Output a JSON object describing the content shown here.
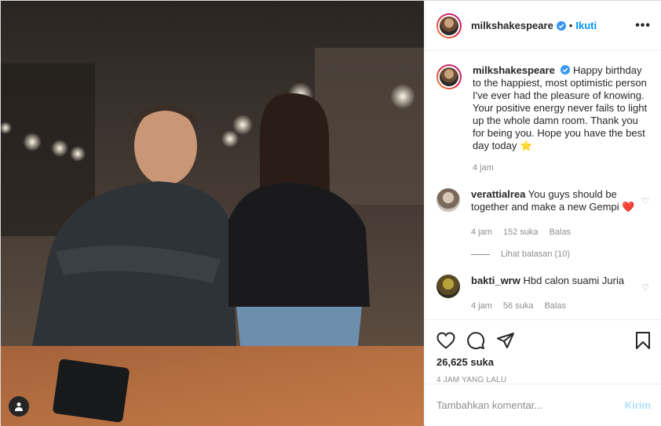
{
  "header": {
    "username": "milkshakespeare",
    "separator": "•",
    "follow_label": "Ikuti",
    "more_label": "•••"
  },
  "caption": {
    "username": "milkshakespeare",
    "text": "Happy birthday to the happiest, most optimistic person I've ever had the pleasure of knowing. Your positive energy never fails to light up the whole damn room. Thank you for being you. Hope you have the best day today ⭐",
    "time": "4 jam"
  },
  "comments": [
    {
      "username": "verattialrea",
      "text": "You guys should be together and make a new Gempi ❤️",
      "time": "4 jam",
      "likes": "152 suka",
      "reply_label": "Balas",
      "view_replies": "Lihat balasan (10)"
    },
    {
      "username": "bakti_wrw",
      "text": "Hbd calon suami Juria",
      "time": "4 jam",
      "likes": "56 suka",
      "reply_label": "Balas"
    }
  ],
  "actions": {
    "likes": "26,625 suka",
    "timestamp": "4 JAM YANG LALU"
  },
  "add_comment": {
    "placeholder": "Tambahkan komentar...",
    "send_label": "Kirim"
  },
  "colors": {
    "accent": "#0095f6",
    "send_disabled": "#b2dffc",
    "verified": "#3897f0"
  },
  "icons": [
    "verified-icon",
    "more-icon",
    "heart-icon",
    "comment-icon",
    "share-icon",
    "bookmark-icon",
    "user-tag-icon"
  ]
}
